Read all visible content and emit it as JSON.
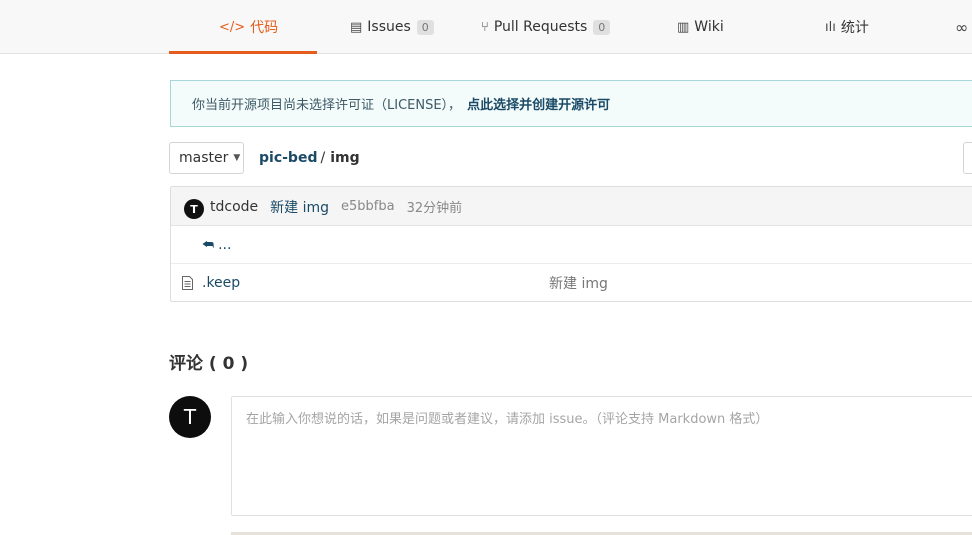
{
  "tabs": [
    {
      "label": "代码",
      "icon": "code-icon",
      "active": true
    },
    {
      "label": "Issues",
      "icon": "issues-icon",
      "count": "0"
    },
    {
      "label": "Pull Requests",
      "icon": "pull-request-icon",
      "count": "0"
    },
    {
      "label": "Wiki",
      "icon": "wiki-icon"
    },
    {
      "label": "统计",
      "icon": "stats-icon"
    }
  ],
  "notice": {
    "text": "你当前开源项目尚未选择许可证（LICENSE），",
    "link": "点此选择并创建开源许可"
  },
  "branch": {
    "name": "master"
  },
  "breadcrumb": {
    "repo": "pic-bed",
    "separator": "/",
    "current": "img"
  },
  "latest_commit": {
    "avatar_letter": "T",
    "author": "tdcode",
    "message": "新建 img",
    "sha": "e5bbfba",
    "time": "32分钟前"
  },
  "parent_dir": {
    "label": "..."
  },
  "files": [
    {
      "name": ".keep",
      "commit_message": "新建 img",
      "icon": "file-icon"
    }
  ],
  "comments": {
    "title": "评论 ( 0 )",
    "avatar_letter": "T",
    "placeholder": "在此输入你想说的话，如果是问题或者建议，请添加 issue。（评论支持 Markdown 格式）"
  },
  "colors": {
    "accent": "#e45d1c",
    "link": "#1b4a66",
    "notice_border": "#a8d7d9",
    "notice_bg": "#f3fbfb"
  }
}
